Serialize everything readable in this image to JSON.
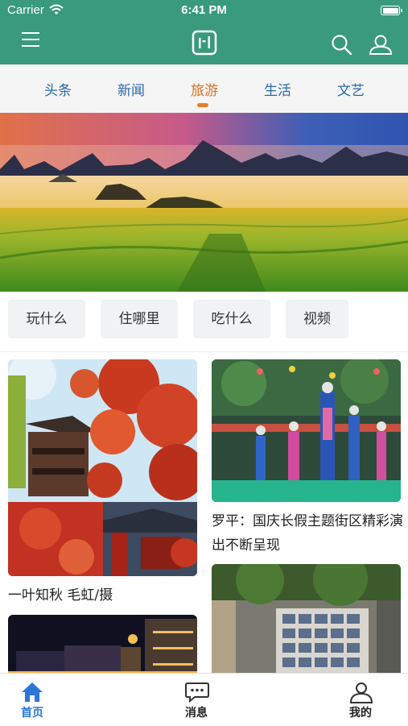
{
  "status_bar": {
    "carrier": "Carrier",
    "time": "6:41 PM"
  },
  "header": {
    "menu_icon": "menu-icon",
    "logo_icon": "app-logo-icon",
    "search_icon": "search-icon",
    "profile_icon": "user-icon",
    "bg_color": "#3a9a7c"
  },
  "tabs": [
    {
      "label": "头条"
    },
    {
      "label": "新闻"
    },
    {
      "label": "旅游",
      "active": true
    },
    {
      "label": "生活"
    },
    {
      "label": "文艺"
    }
  ],
  "accent_color": "#e87c28",
  "subcategories": [
    "玩什么",
    "住哪里",
    "吃什么",
    "视频"
  ],
  "feed": {
    "left": [
      {
        "caption": "一叶知秋  毛虹/摄",
        "image": "autumn-red-leaves-pavilion"
      },
      {
        "caption": "",
        "image": "night-street-lights"
      }
    ],
    "right": [
      {
        "caption": "罗平：国庆长假主题街区精彩演出不断呈现",
        "image": "ethnic-dance-performance"
      },
      {
        "caption": "",
        "image": "photo-exhibition-wall"
      }
    ]
  },
  "bottom_nav": [
    {
      "label": "首页",
      "icon": "home-icon",
      "active": true
    },
    {
      "label": "消息",
      "icon": "message-icon"
    },
    {
      "label": "我的",
      "icon": "profile-icon"
    }
  ]
}
